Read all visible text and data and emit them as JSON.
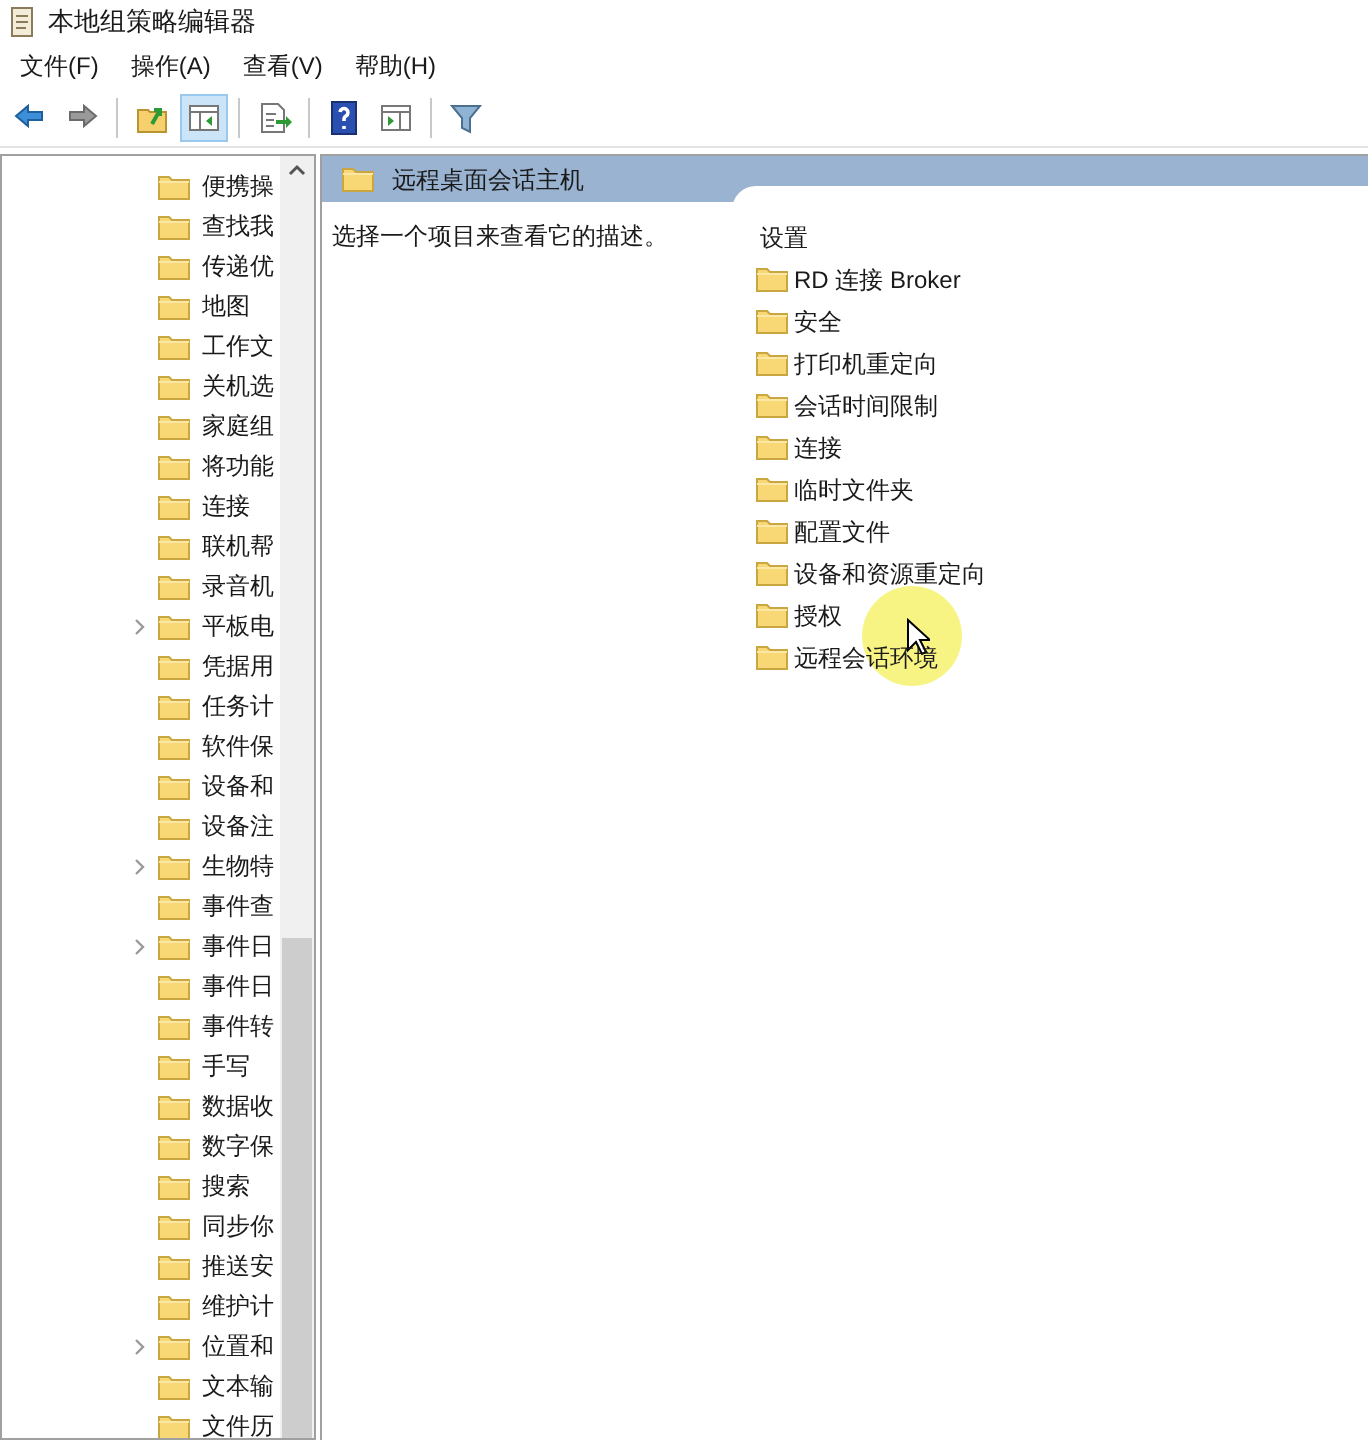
{
  "window": {
    "title": "本地组策略编辑器"
  },
  "menu": [
    {
      "label": "文件(F)"
    },
    {
      "label": "操作(A)"
    },
    {
      "label": "查看(V)"
    },
    {
      "label": "帮助(H)"
    }
  ],
  "toolbar": [
    {
      "kind": "back",
      "selected": false
    },
    {
      "kind": "forward",
      "selected": false
    },
    {
      "kind": "separator"
    },
    {
      "kind": "up",
      "selected": false
    },
    {
      "kind": "tree",
      "selected": true
    },
    {
      "kind": "separator"
    },
    {
      "kind": "export",
      "selected": false
    },
    {
      "kind": "separator"
    },
    {
      "kind": "help",
      "selected": false
    },
    {
      "kind": "pane",
      "selected": false
    },
    {
      "kind": "separator"
    },
    {
      "kind": "filter",
      "selected": false
    }
  ],
  "tree": {
    "items": [
      {
        "label": "便携操",
        "has_children": false
      },
      {
        "label": "查找我",
        "has_children": false
      },
      {
        "label": "传递优",
        "has_children": false
      },
      {
        "label": "地图",
        "has_children": false
      },
      {
        "label": "工作文",
        "has_children": false
      },
      {
        "label": "关机选",
        "has_children": false
      },
      {
        "label": "家庭组",
        "has_children": false
      },
      {
        "label": "将功能",
        "has_children": false
      },
      {
        "label": "连接",
        "has_children": false
      },
      {
        "label": "联机帮",
        "has_children": false
      },
      {
        "label": "录音机",
        "has_children": false
      },
      {
        "label": "平板电",
        "has_children": true
      },
      {
        "label": "凭据用",
        "has_children": false
      },
      {
        "label": "任务计",
        "has_children": false
      },
      {
        "label": "软件保",
        "has_children": false
      },
      {
        "label": "设备和",
        "has_children": false
      },
      {
        "label": "设备注",
        "has_children": false
      },
      {
        "label": "生物特",
        "has_children": true
      },
      {
        "label": "事件查",
        "has_children": false
      },
      {
        "label": "事件日",
        "has_children": true
      },
      {
        "label": "事件日",
        "has_children": false
      },
      {
        "label": "事件转",
        "has_children": false
      },
      {
        "label": "手写",
        "has_children": false
      },
      {
        "label": "数据收",
        "has_children": false
      },
      {
        "label": "数字保",
        "has_children": false
      },
      {
        "label": "搜索",
        "has_children": false
      },
      {
        "label": "同步你",
        "has_children": false
      },
      {
        "label": "推送安",
        "has_children": false
      },
      {
        "label": "维护计",
        "has_children": false
      },
      {
        "label": "位置和",
        "has_children": true
      },
      {
        "label": "文本输",
        "has_children": false
      },
      {
        "label": "文件历",
        "has_children": false
      }
    ]
  },
  "details": {
    "title": "远程桌面会话主机",
    "description": "选择一个项目来查看它的描述。",
    "column_header": "设置",
    "items": [
      {
        "label": "RD 连接 Broker"
      },
      {
        "label": "安全"
      },
      {
        "label": "打印机重定向"
      },
      {
        "label": "会话时间限制"
      },
      {
        "label": "连接"
      },
      {
        "label": "临时文件夹"
      },
      {
        "label": "配置文件"
      },
      {
        "label": "设备和资源重定向"
      },
      {
        "label": "授权"
      },
      {
        "label": "远程会话环境"
      }
    ]
  }
}
